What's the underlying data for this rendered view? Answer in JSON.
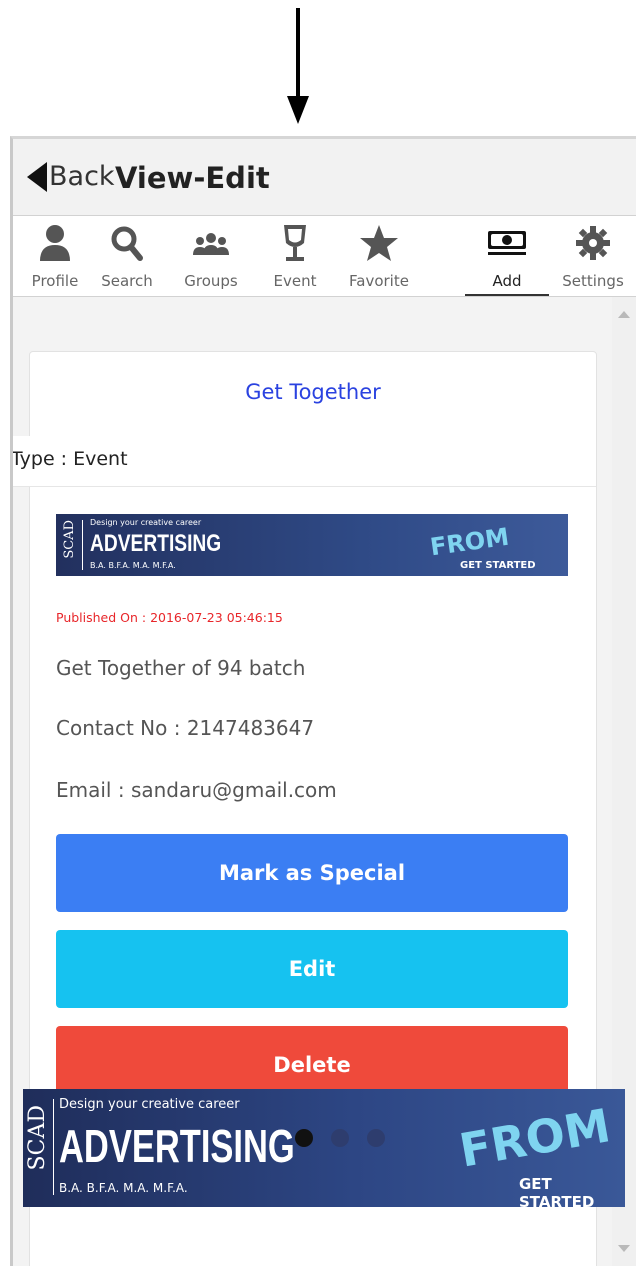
{
  "header": {
    "back_label": "Back",
    "title": "View-Edit"
  },
  "tabs": [
    {
      "label": "Profile",
      "icon": "profile-icon"
    },
    {
      "label": "Search",
      "icon": "search-icon"
    },
    {
      "label": "Groups",
      "icon": "groups-icon"
    },
    {
      "label": "Event",
      "icon": "event-glass-icon"
    },
    {
      "label": "Favorite",
      "icon": "star-icon"
    },
    {
      "label": "Add",
      "icon": "money-icon",
      "active": true
    },
    {
      "label": "Settings",
      "icon": "gear-icon"
    }
  ],
  "card": {
    "title": "Get Together",
    "type": "Type : Event",
    "published": "Published On : 2016-07-23 05:46:15",
    "description": "Get Together of 94 batch",
    "contact": "Contact No : 2147483647",
    "email": "Email : sandaru@gmail.com"
  },
  "buttons": {
    "special": "Mark as Special",
    "edit": "Edit",
    "delete": "Delete"
  },
  "ad": {
    "brand": "SCAD",
    "tagline": "Design your creative career",
    "headline": "ADVERTISING",
    "degrees": "B.A. B.F.A. M.A. M.F.A.",
    "cta": "GET STARTED",
    "art": "FROM"
  },
  "carousel": {
    "dots": 3,
    "active_index": 0
  },
  "colors": {
    "special": "#3b7ef3",
    "edit": "#16c2f0",
    "delete": "#ef4a3b",
    "title": "#2a42e0",
    "published": "#e8262a"
  }
}
